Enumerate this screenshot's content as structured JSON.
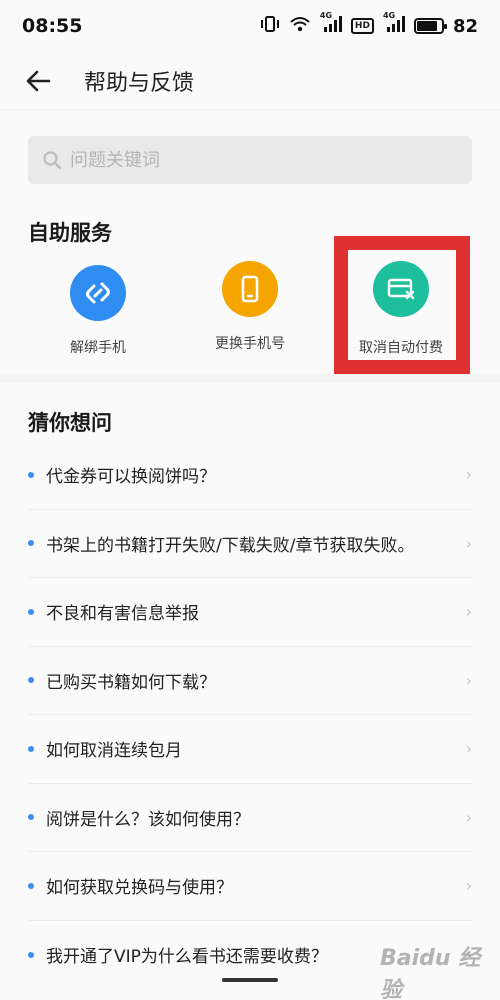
{
  "status_bar": {
    "time": "08:55",
    "net_badge_1": "4G",
    "net_badge_2": "4G",
    "hd_badge": "HD",
    "battery": "82"
  },
  "header": {
    "title": "帮助与反馈"
  },
  "search": {
    "placeholder": "问题关键词"
  },
  "self_service": {
    "title": "自助服务",
    "items": [
      {
        "label": "解绑手机",
        "icon": "unlink-icon",
        "color": "#2f8cf0"
      },
      {
        "label": "更换手机号",
        "icon": "phone-icon",
        "color": "#f6a400"
      },
      {
        "label": "取消自动付费",
        "icon": "card-cancel-icon",
        "color": "#1dbf9c"
      }
    ]
  },
  "faq": {
    "title": "猜你想问",
    "items": [
      "代金券可以换阅饼吗？",
      "书架上的书籍打开失败/下载失败/章节获取失败。",
      "不良和有害信息举报",
      "已购买书籍如何下载？",
      "如何取消连续包月",
      "阅饼是什么？该如何使用？",
      "如何获取兑换码与使用？",
      "我开通了VIP为什么看书还需要收费？"
    ]
  },
  "watermark": "Baidu 经验",
  "colors": {
    "highlight": "#e03131",
    "accent_dot": "#3b8ff0"
  }
}
